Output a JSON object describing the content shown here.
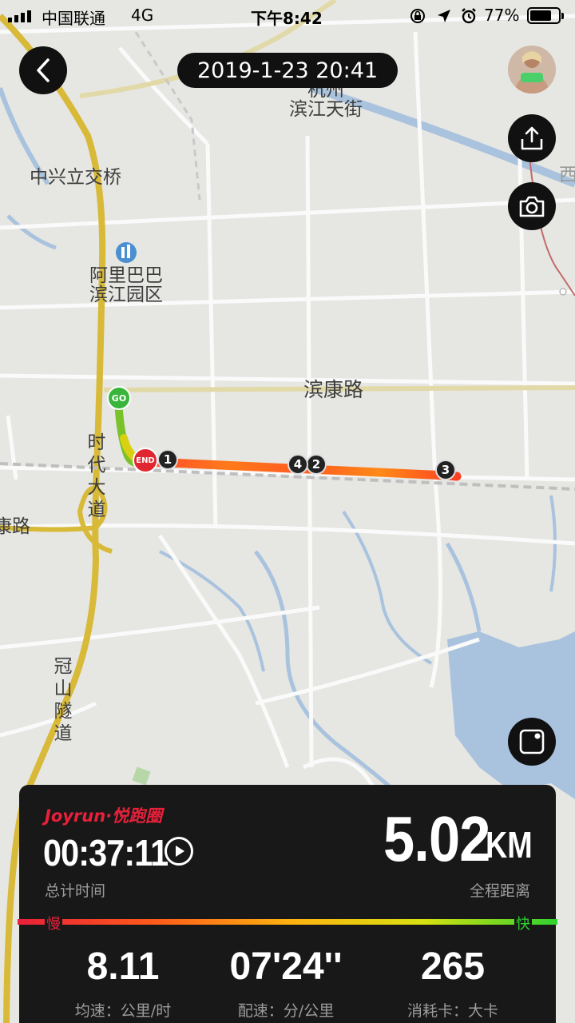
{
  "status_bar": {
    "carrier": "中国联通",
    "network": "4G",
    "time": "下午8:42",
    "battery": "77%",
    "battery_level": 0.77
  },
  "header": {
    "date_time": "2019-1-23 20:41"
  },
  "map": {
    "labels": {
      "binjiang_street": "杭州\n滨江天街",
      "zhongxing_bridge": "中兴立交桥",
      "alibaba_park": "阿里巴巴\n滨江园区",
      "binkang_road": "滨康路",
      "shidai_avenue": "时代大道",
      "guanshan_tunnel": "冠山隧道",
      "left_road": "康路",
      "right_edge": "西"
    },
    "markers": {
      "start": "GO",
      "end": "END",
      "km_1": "1",
      "km_2": "2",
      "km_3": "3",
      "km_4": "4"
    }
  },
  "summary": {
    "brand": "Joyrun",
    "brand_cn": "·悦跑圈",
    "total_time": "00:37:11",
    "total_time_label": "总计时间",
    "distance_value": "5.02",
    "distance_unit": "KM",
    "distance_label": "全程距离",
    "pace_slow_label": "慢",
    "pace_fast_label": "快",
    "stats": [
      {
        "value": "8.11",
        "label": "均速：公里/时"
      },
      {
        "value": "07'24''",
        "label": "配速：分/公里"
      },
      {
        "value": "265",
        "label": "消耗卡：大卡"
      }
    ]
  },
  "colors": {
    "brand_red": "#e8203a",
    "pace_slow": "#e8203a",
    "pace_fast": "#2ed12e",
    "route_orange": "#ff6a1a",
    "panel_bg": "#181818"
  }
}
